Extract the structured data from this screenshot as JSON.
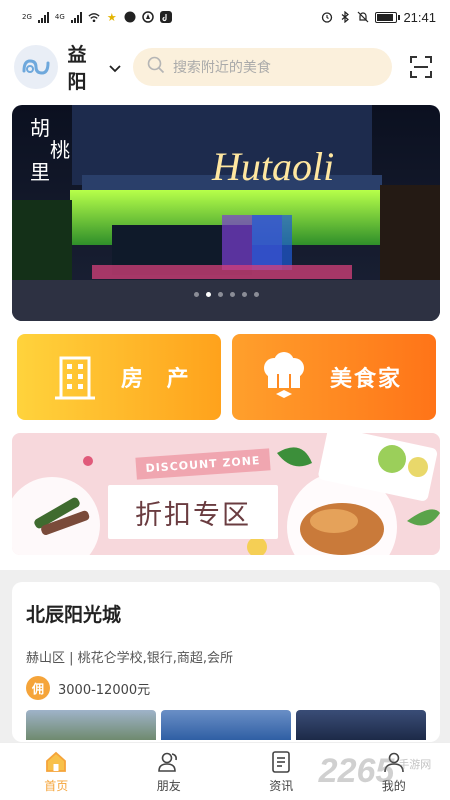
{
  "status_bar": {
    "sim1": "2G",
    "sim2": "4G",
    "time": "21:41"
  },
  "header": {
    "city": "益阳",
    "search_placeholder": "搜索附近的美食"
  },
  "banner": {
    "slides_count": 6,
    "active_index": 1
  },
  "categories": [
    {
      "label": "房 产",
      "icon": "building-icon"
    },
    {
      "label": "美食家",
      "icon": "chef-hat-icon"
    }
  ],
  "discount": {
    "ribbon": "DISCOUNT ZONE",
    "title": "折扣专区"
  },
  "listing": {
    "title": "北辰阳光城",
    "meta": "赫山区 | 桃花仑学校,银行,商超,会所",
    "commission_badge": "佣",
    "price": "3000-12000元"
  },
  "tabbar": {
    "tabs": [
      {
        "label": "首页",
        "icon": "home-icon",
        "active": true
      },
      {
        "label": "朋友",
        "icon": "friends-icon",
        "active": false
      },
      {
        "label": "资讯",
        "icon": "news-icon",
        "active": false
      },
      {
        "label": "我的",
        "icon": "profile-icon",
        "active": false
      }
    ]
  },
  "watermark": {
    "number": "2265",
    "text": "手游网"
  },
  "colors": {
    "accent": "#f5a43a",
    "search_bg": "#fbf0dc",
    "discount_bg": "#f7d8dc"
  }
}
